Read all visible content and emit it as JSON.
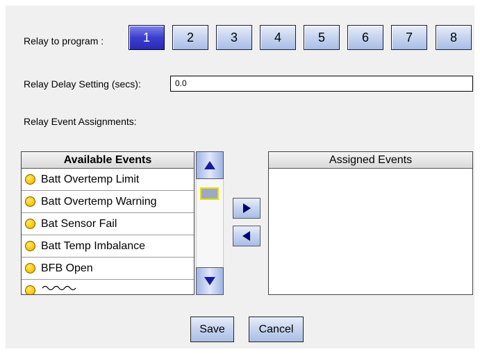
{
  "relay": {
    "label": "Relay to program :",
    "buttons": [
      "1",
      "2",
      "3",
      "4",
      "5",
      "6",
      "7",
      "8"
    ],
    "selected": "1"
  },
  "delay": {
    "label": "Relay Delay Setting (secs):",
    "value": "0.0"
  },
  "assignments_label": "Relay Event Assignments:",
  "available": {
    "header": "Available Events",
    "items": [
      "Batt Overtemp Limit",
      "Batt Overtemp Warning",
      "Bat Sensor Fail",
      "Batt Temp Imbalance",
      "BFB Open"
    ]
  },
  "assigned": {
    "header": "Assigned Events",
    "items": []
  },
  "buttons": {
    "save": "Save",
    "cancel": "Cancel"
  },
  "colors": {
    "event_indicator": "#ffcc00",
    "selected_relay": "#3b3fd0",
    "arrow": "#1a1aa0"
  }
}
